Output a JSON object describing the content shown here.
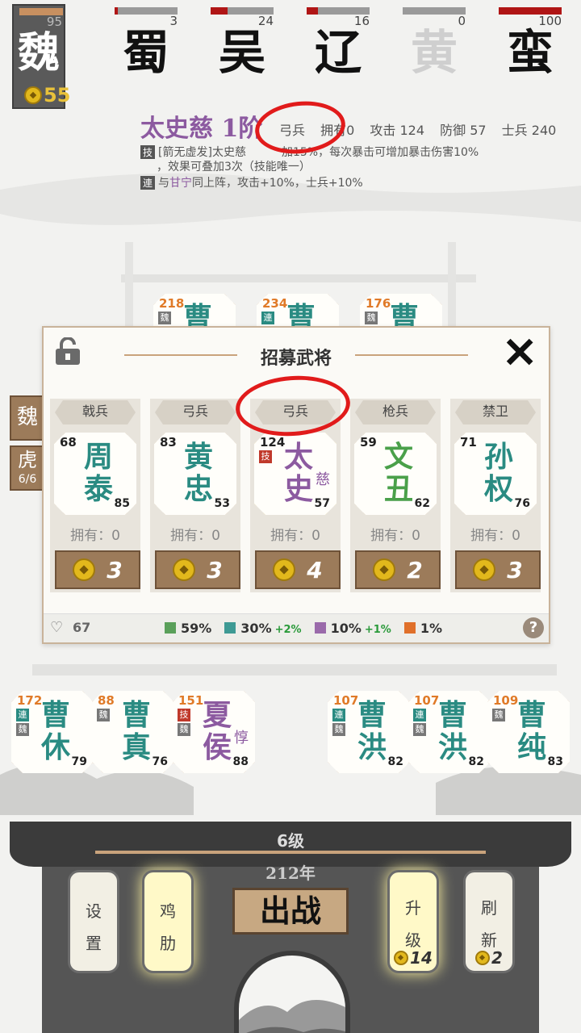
{
  "factions": [
    {
      "name": "魏",
      "hp": 95,
      "hp_fraction": 1.0,
      "own": true
    },
    {
      "name": "蜀",
      "hp": 3,
      "hp_fraction": 0.05
    },
    {
      "name": "吴",
      "hp": 24,
      "hp_fraction": 0.27
    },
    {
      "name": "辽",
      "hp": 16,
      "hp_fraction": 0.18
    },
    {
      "name": "黄",
      "hp": 0,
      "hp_fraction": 0.0,
      "dim": true
    },
    {
      "name": "蛮",
      "hp": 100,
      "hp_fraction": 1.0
    }
  ],
  "gold": "55",
  "general_info": {
    "name": "太史慈 1阶",
    "troop": "弓兵",
    "owned": "拥有0",
    "attack": "攻击 124",
    "defense": "防御 57",
    "soldiers": "士兵 240",
    "skill_tag": "技",
    "skill_text_1": "[箭无虚发]太史慈",
    "skill_text_1b": "加15%，每次暴击可增加暴击伤害10%",
    "skill_text_2": "，效果可叠加3次（技能唯一）",
    "link_tag": "連",
    "link_text_pre": "与",
    "link_partner": "甘宁",
    "link_text_post": "同上阵，攻击+10%，士兵+10%"
  },
  "board_top": [
    {
      "num": "218",
      "name": "曹",
      "badge": "魏"
    },
    {
      "num": "234",
      "name": "曹",
      "badge": "連"
    },
    {
      "num": "176",
      "name": "曹",
      "badge": "魏"
    }
  ],
  "dialog": {
    "title": "招募武将",
    "slots": [
      {
        "type": "戟兵",
        "atk": "68",
        "name": "周泰",
        "def": "85",
        "owned": "拥有：0",
        "price": "3"
      },
      {
        "type": "弓兵",
        "atk": "83",
        "name": "黄忠",
        "def": "53",
        "owned": "拥有：0",
        "price": "3"
      },
      {
        "type": "弓兵",
        "atk": "124",
        "name": "太史",
        "sub": "慈",
        "def": "57",
        "owned": "拥有：0",
        "price": "4",
        "skill": "技",
        "purple": true,
        "selected": true
      },
      {
        "type": "枪兵",
        "atk": "59",
        "name": "文丑",
        "def": "62",
        "owned": "拥有：0",
        "price": "2"
      },
      {
        "type": "禁卫",
        "atk": "71",
        "name": "孙权",
        "def": "76",
        "owned": "拥有：0",
        "price": "3"
      }
    ],
    "hearts": "67",
    "odds": [
      {
        "color": "#5aa05a",
        "pct": "59%",
        "inc": ""
      },
      {
        "color": "#3e9a94",
        "pct": "30%",
        "inc": "+2%"
      },
      {
        "color": "#9a6aaa",
        "pct": "10%",
        "inc": "+1%"
      },
      {
        "color": "#e0702a",
        "pct": "1%",
        "inc": ""
      }
    ],
    "help": "?"
  },
  "side_tabs": [
    {
      "label": "魏"
    },
    {
      "label": "虎",
      "sub": "6/6"
    }
  ],
  "bench": [
    {
      "num": "172",
      "name": "曹休",
      "def": "79",
      "badges": [
        "連",
        "魏"
      ]
    },
    {
      "num": "88",
      "name": "曹真",
      "def": "76",
      "badges": [
        "魏"
      ]
    },
    {
      "num": "151",
      "name": "夏侯",
      "sub": "惇",
      "def": "88",
      "badges": [
        "技",
        "魏"
      ],
      "purple": true
    },
    {
      "num": "107",
      "name": "曹洪",
      "def": "82",
      "badges": [
        "連",
        "魏"
      ]
    },
    {
      "num": "107",
      "name": "曹洪",
      "def": "82",
      "badges": [
        "連",
        "魏"
      ]
    },
    {
      "num": "109",
      "name": "曹纯",
      "def": "83",
      "badges": [
        "魏"
      ]
    }
  ],
  "bottom": {
    "level": "6级",
    "year": "212年",
    "settings": "设置",
    "chicken": "鸡肋",
    "battle": "出战",
    "upgrade": "升级",
    "upgrade_cost": "14",
    "refresh": "刷新",
    "refresh_cost": "2"
  }
}
